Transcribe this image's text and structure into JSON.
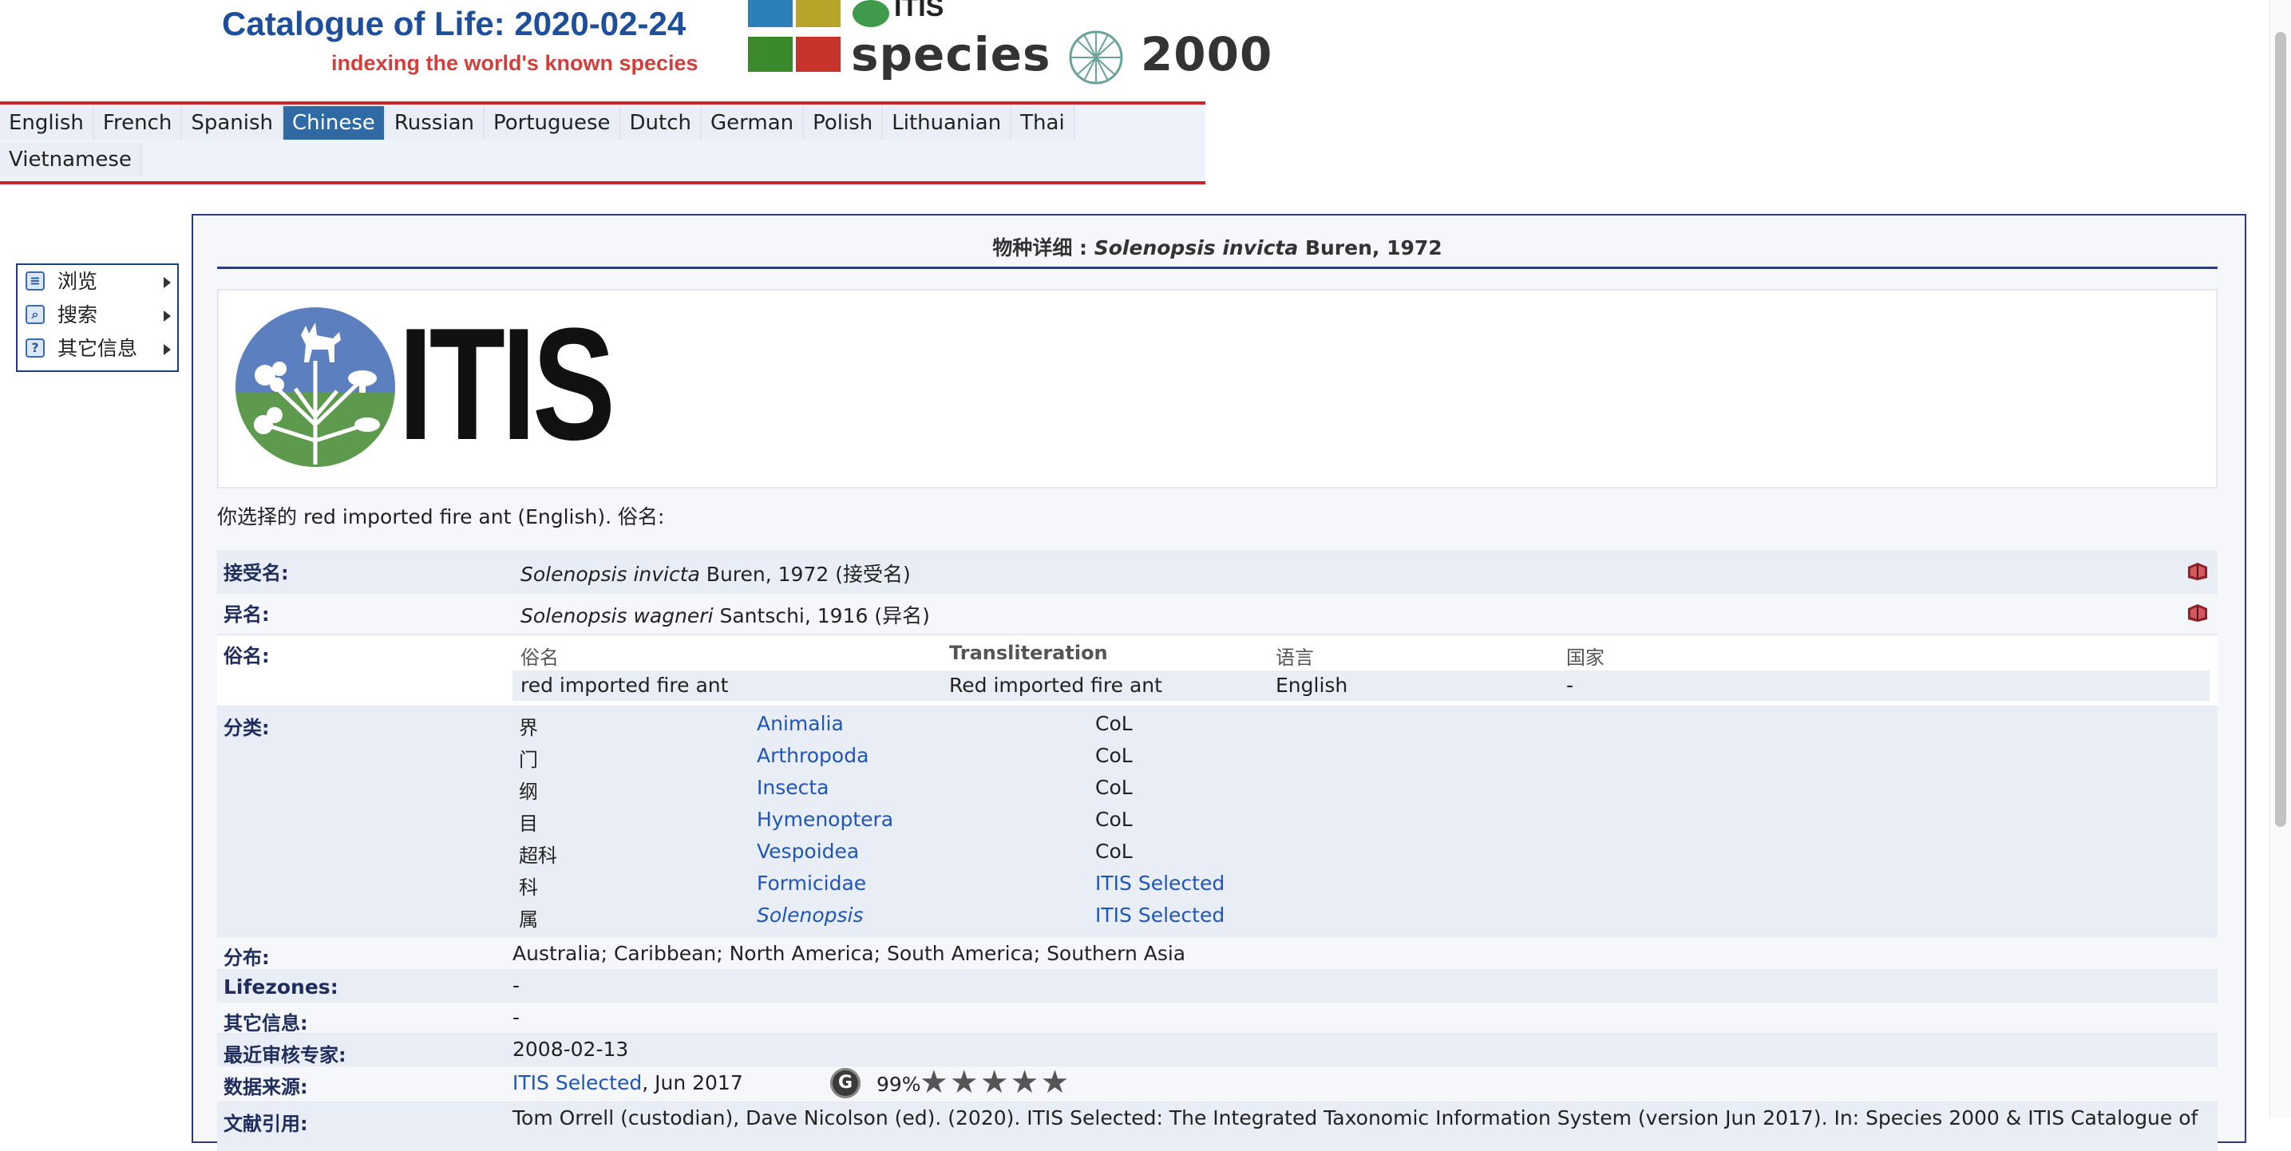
{
  "header": {
    "title": "Catalogue of Life: 2020-02-24",
    "tagline": "indexing the world's known species",
    "logo_itis": "ITIS",
    "logo_species": "species",
    "logo_2000": "2000"
  },
  "languages": {
    "row1": [
      "English",
      "French",
      "Spanish",
      "Chinese",
      "Russian",
      "Portuguese",
      "Dutch",
      "German",
      "Polish",
      "Lithuanian",
      "Thai"
    ],
    "row2": [
      "Vietnamese"
    ],
    "active": "Chinese"
  },
  "menu": {
    "items": [
      {
        "label": "浏览",
        "icon": "page-icon"
      },
      {
        "label": "搜索",
        "icon": "magnifier-icon"
      },
      {
        "label": "其它信息",
        "icon": "help-icon"
      }
    ]
  },
  "species": {
    "title_prefix": "物种详细 : ",
    "title_name": "Solenopsis invicta",
    "title_author": " Buren, 1972",
    "logo_text": "ITIS",
    "selected_line": "你选择的 red imported fire ant (English). 俗名:",
    "accepted_label": "接受名:",
    "accepted_name": "Solenopsis invicta",
    "accepted_rest": " Buren, 1972 (接受名)",
    "synonym_label": "异名:",
    "synonym_name": "Solenopsis wagneri",
    "synonym_rest": " Santschi, 1916 (异名)",
    "common_label": "俗名:",
    "common_headers": {
      "name": "俗名",
      "translit": "Transliteration",
      "language": "语言",
      "country": "国家"
    },
    "common_row": {
      "name": "red imported fire ant",
      "translit": "Red imported fire ant",
      "language": "English",
      "country": "-"
    },
    "classification_label": "分类:",
    "classification": [
      {
        "rank": "界",
        "name": "Animalia",
        "source": "CoL"
      },
      {
        "rank": "门",
        "name": "Arthropoda",
        "source": "CoL"
      },
      {
        "rank": "纲",
        "name": "Insecta",
        "source": "CoL"
      },
      {
        "rank": "目",
        "name": "Hymenoptera",
        "source": "CoL"
      },
      {
        "rank": "超科",
        "name": "Vespoidea",
        "source": "CoL"
      },
      {
        "rank": "科",
        "name": "Formicidae",
        "source": "ITIS Selected"
      },
      {
        "rank": "属",
        "name": "Solenopsis",
        "source": "ITIS Selected"
      }
    ],
    "distribution_label": "分布:",
    "distribution": "Australia; Caribbean; North America; South America; Southern Asia",
    "lifezones_label": "Lifezones:",
    "lifezones": "-",
    "other_label": "其它信息:",
    "other": "-",
    "reviewer_label": "最近审核专家:",
    "reviewer": "2008-02-13",
    "source_label": "数据来源:",
    "source_link": "ITIS Selected",
    "source_date": ", Jun 2017",
    "source_badge": "G",
    "source_percent": "99%",
    "source_stars": 5,
    "citation_label": "文献引用:",
    "citation": "Tom Orrell (custodian), Dave Nicolson (ed). (2020). ITIS Selected: The Integrated Taxonomic Information System (version Jun 2017). In: Species 2000 & ITIS Catalogue of"
  }
}
